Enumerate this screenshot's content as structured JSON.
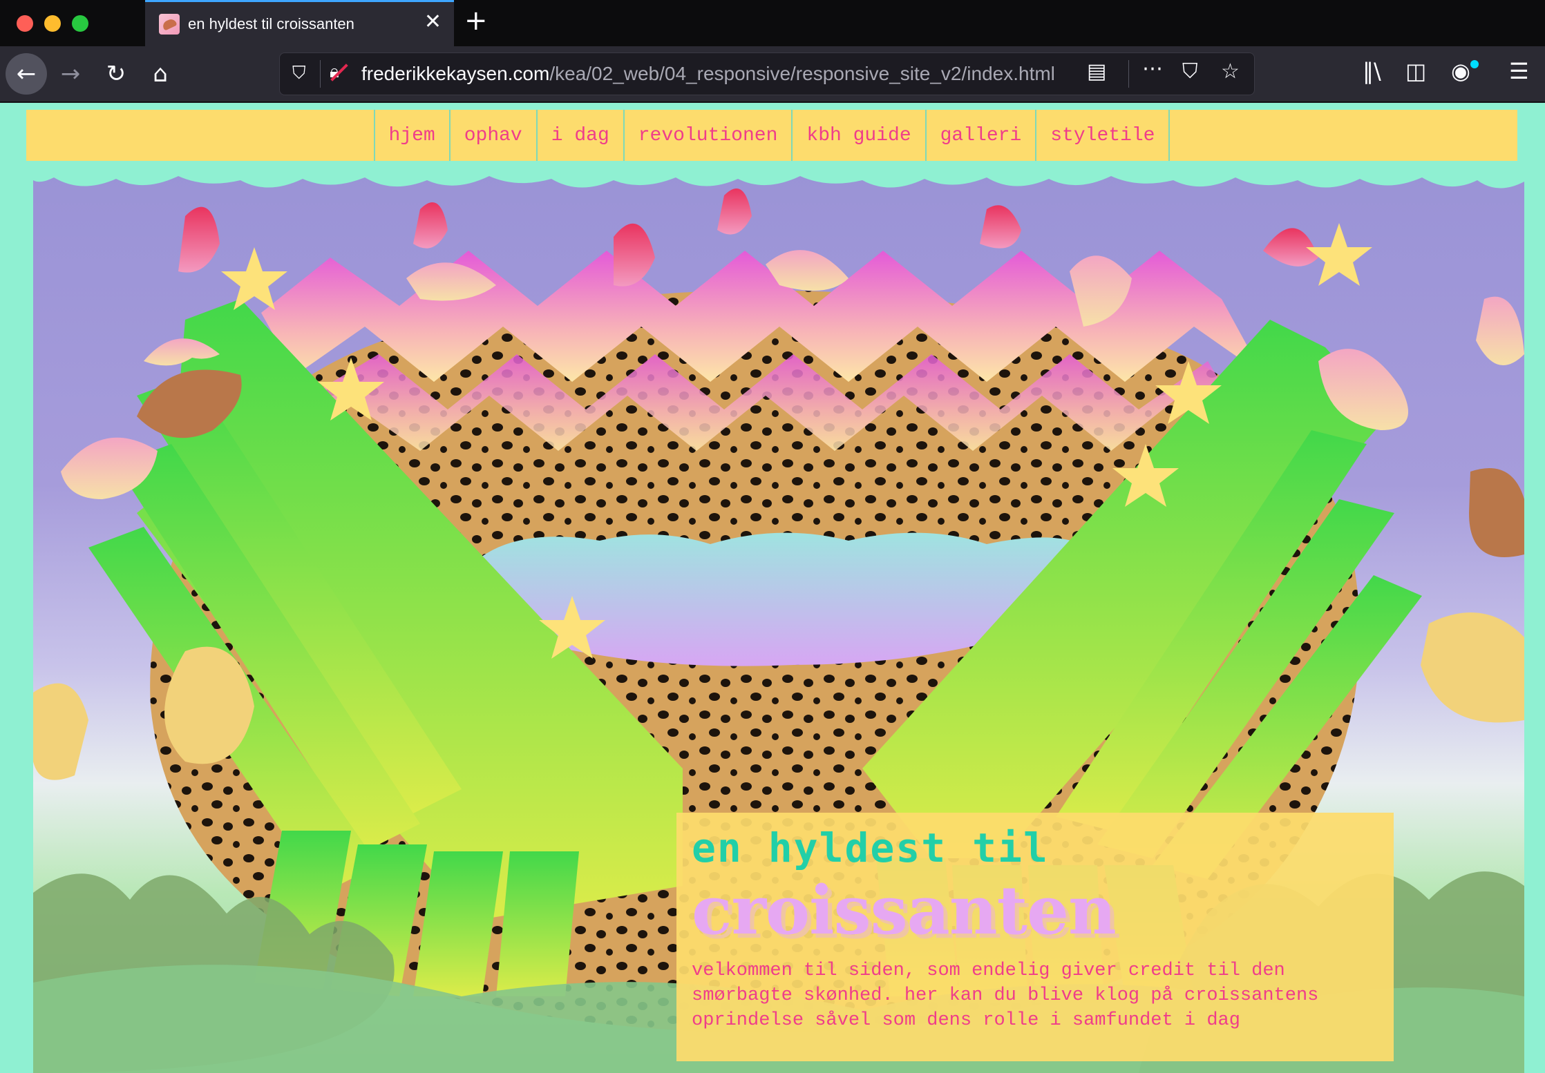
{
  "browser": {
    "tab_title": "en hyldest til croissanten",
    "url_host": "frederikkekaysen.com",
    "url_path": "/kea/02_web/04_responsive/responsive_site_v2/index.html"
  },
  "nav": {
    "items": [
      "hjem",
      "ophav",
      "i dag",
      "revolutionen",
      "kbh guide",
      "galleri",
      "styletile"
    ]
  },
  "hero": {
    "kicker": "en hyldest til",
    "title": "croissanten",
    "text": "velkommen til siden, som endelig giver credit til den smørbagte skønhed. her kan du blive klog på croissantens oprindelse såvel som dens rolle i samfundet i dag"
  },
  "colors": {
    "page_bg": "#8ff0d2",
    "nav_bg": "#fddc6d",
    "nav_text": "#ef3d8a",
    "kicker": "#22cfa8",
    "title": "#e6a8f2"
  }
}
